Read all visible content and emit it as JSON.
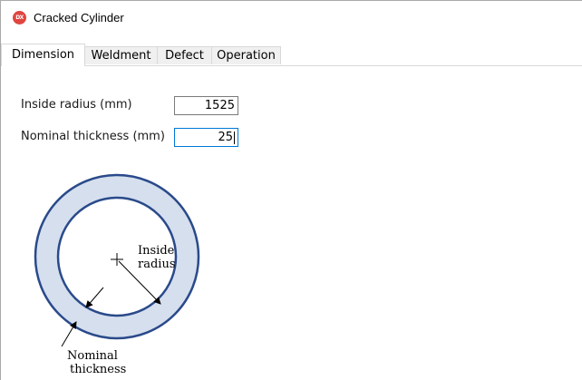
{
  "window": {
    "title": "Cracked Cylinder",
    "icon": "app-logo-icon",
    "icon_text": "DX",
    "icon_color": "#e0453f"
  },
  "tabs": [
    {
      "label": "Dimension",
      "active": true
    },
    {
      "label": "Weldment",
      "active": false
    },
    {
      "label": "Defect",
      "active": false
    },
    {
      "label": "Operation",
      "active": false
    }
  ],
  "form": {
    "inside_radius": {
      "label": "Inside radius (mm)",
      "value": "1525"
    },
    "nominal_thickness": {
      "label": "Nominal thickness (mm)",
      "value": "25"
    }
  },
  "diagram": {
    "inside_radius_label_line1": "Inside",
    "inside_radius_label_line2": "radius",
    "thickness_label_line1": "Nominal",
    "thickness_label_line2": "thickness",
    "ring_fill": "#d5dfee",
    "ring_stroke": "#2a4a8a"
  }
}
